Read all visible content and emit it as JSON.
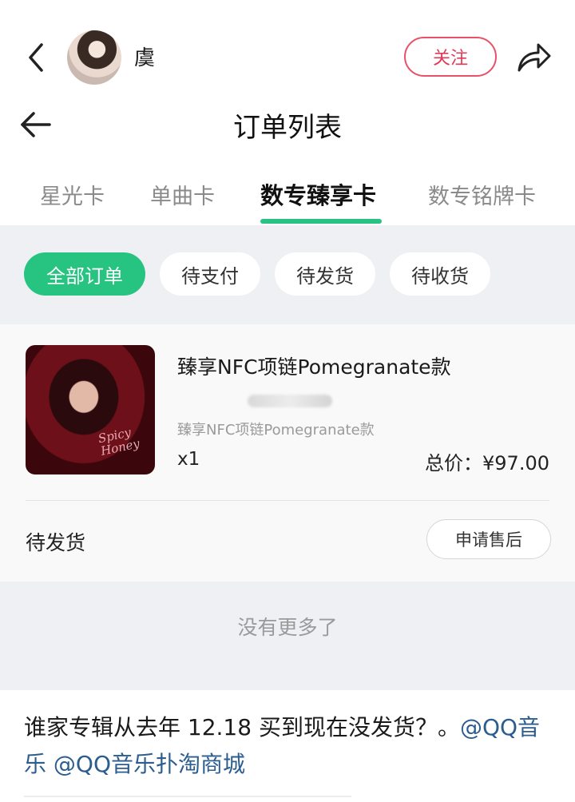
{
  "topbar": {
    "username": "虞",
    "follow_label": "关注",
    "icons": {
      "back": "chevron-left-icon",
      "share": "share-arrow-icon"
    }
  },
  "page": {
    "title": "订单列表"
  },
  "tabs": [
    {
      "label": "星光卡"
    },
    {
      "label": "单曲卡"
    },
    {
      "label": "数专臻享卡",
      "active": true
    },
    {
      "label": "数专铭牌卡"
    }
  ],
  "filters": [
    {
      "label": "全部订单",
      "active": true
    },
    {
      "label": "待支付"
    },
    {
      "label": "待发货"
    },
    {
      "label": "待收货"
    }
  ],
  "order": {
    "product_name": "臻享NFC项链Pomegranate款",
    "product_sub": "臻享NFC项链Pomegranate款",
    "quantity": "x1",
    "total": "总价：¥97.00",
    "status": "待发货",
    "aftersale_label": "申请售后",
    "cover_text": "Spicy Honey"
  },
  "footer": {
    "no_more": "没有更多了"
  },
  "post": {
    "text": "谁家专辑从去年 12.18 买到现在没发货？。",
    "mentions": [
      "@QQ音乐",
      "@QQ音乐扑淘商城"
    ]
  },
  "colors": {
    "accent_green": "#27c381",
    "follow_red": "#e23a56",
    "mention_blue": "#2b5d8f"
  }
}
